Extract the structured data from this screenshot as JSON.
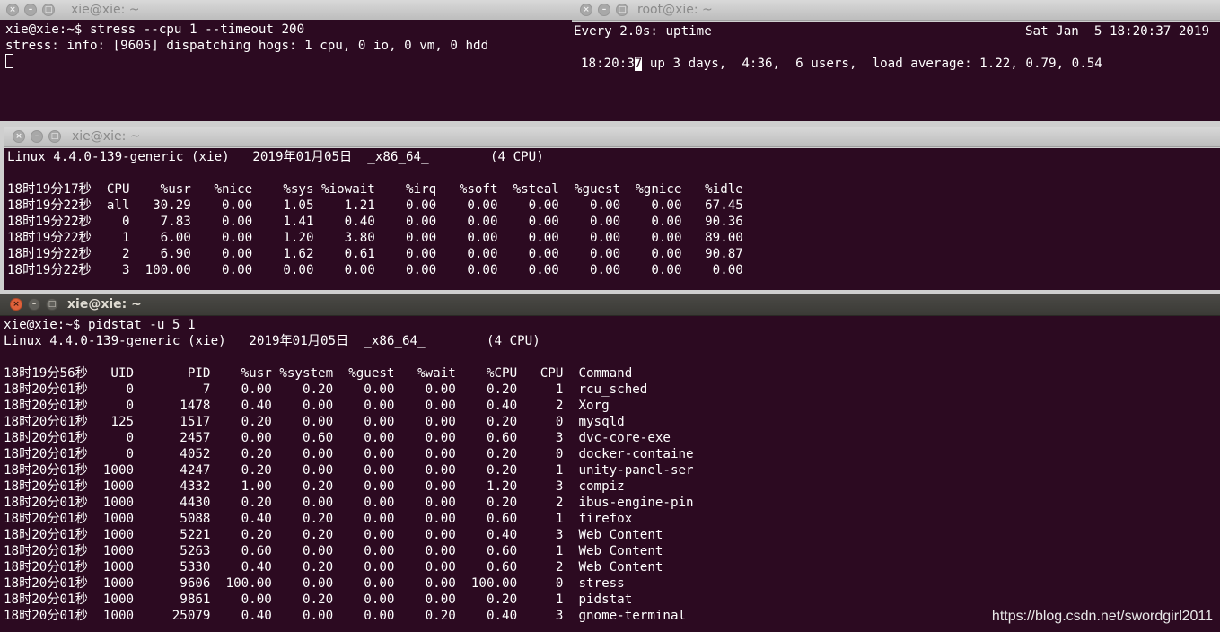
{
  "window_stress": {
    "title": "xie@xie: ~",
    "lines": [
      "xie@xie:~$ stress --cpu 1 --timeout 200",
      "stress: info: [9605] dispatching hogs: 1 cpu, 0 io, 0 vm, 0 hdd"
    ]
  },
  "window_uptime": {
    "title": "root@xie: ~",
    "header_left": "Every 2.0s: uptime",
    "header_right": "Sat Jan  5 18:20:37 2019",
    "uptime_pre": "18:20:3",
    "uptime_cursor": "7",
    "uptime_post": " up 3 days,  4:36,  6 users,  load average: 1.22, 0.79, 0.54"
  },
  "window_mpstat": {
    "title": "xie@xie: ~",
    "lines": [
      "Linux 4.4.0-139-generic (xie)   2019年01月05日  _x86_64_        (4 CPU)",
      "",
      "18时19分17秒  CPU    %usr   %nice    %sys %iowait    %irq   %soft  %steal  %guest  %gnice   %idle",
      "18时19分22秒  all   30.29    0.00    1.05    1.21    0.00    0.00    0.00    0.00    0.00   67.45",
      "18时19分22秒    0    7.83    0.00    1.41    0.40    0.00    0.00    0.00    0.00    0.00   90.36",
      "18时19分22秒    1    6.00    0.00    1.20    3.80    0.00    0.00    0.00    0.00    0.00   89.00",
      "18时19分22秒    2    6.90    0.00    1.62    0.61    0.00    0.00    0.00    0.00    0.00   90.87",
      "18时19分22秒    3  100.00    0.00    0.00    0.00    0.00    0.00    0.00    0.00    0.00    0.00"
    ]
  },
  "window_pidstat": {
    "title": "xie@xie: ~",
    "lines": [
      "xie@xie:~$ pidstat -u 5 1",
      "Linux 4.4.0-139-generic (xie)   2019年01月05日  _x86_64_        (4 CPU)",
      "",
      "18时19分56秒   UID       PID    %usr %system  %guest   %wait    %CPU   CPU  Command",
      "18时20分01秒     0         7    0.00    0.20    0.00    0.00    0.20     1  rcu_sched",
      "18时20分01秒     0      1478    0.40    0.00    0.00    0.00    0.40     2  Xorg",
      "18时20分01秒   125      1517    0.20    0.00    0.00    0.00    0.20     0  mysqld",
      "18时20分01秒     0      2457    0.00    0.60    0.00    0.00    0.60     3  dvc-core-exe",
      "18时20分01秒     0      4052    0.20    0.00    0.00    0.00    0.20     0  docker-containe",
      "18时20分01秒  1000      4247    0.20    0.00    0.00    0.00    0.20     1  unity-panel-ser",
      "18时20分01秒  1000      4332    1.00    0.20    0.00    0.00    1.20     3  compiz",
      "18时20分01秒  1000      4430    0.20    0.00    0.00    0.00    0.20     2  ibus-engine-pin",
      "18时20分01秒  1000      5088    0.40    0.20    0.00    0.00    0.60     1  firefox",
      "18时20分01秒  1000      5221    0.20    0.20    0.00    0.00    0.40     3  Web Content",
      "18时20分01秒  1000      5263    0.60    0.00    0.00    0.00    0.60     1  Web Content",
      "18时20分01秒  1000      5330    0.40    0.20    0.00    0.00    0.60     2  Web Content",
      "18时20分01秒  1000      9606  100.00    0.00    0.00    0.00  100.00     0  stress",
      "18时20分01秒  1000      9861    0.00    0.20    0.00    0.00    0.20     1  pidstat",
      "18时20分01秒  1000     25079    0.40    0.00    0.00    0.20    0.40     3  gnome-terminal"
    ]
  },
  "watermark": "https://blog.csdn.net/swordgirl2011",
  "colors": {
    "terminal_bg": "#2c0a21",
    "terminal_fg": "#ffffff",
    "close_button_active": "#e0613a"
  },
  "icons": {
    "close": "close-icon",
    "minimize": "minimize-icon",
    "maximize": "maximize-icon"
  }
}
